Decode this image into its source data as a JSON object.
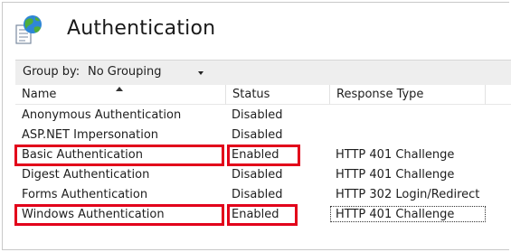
{
  "page": {
    "title": "Authentication"
  },
  "toolbar": {
    "group_by_label": "Group by:",
    "group_by_value": "No Grouping"
  },
  "columns": {
    "name": "Name",
    "status": "Status",
    "response_type": "Response Type"
  },
  "rows": [
    {
      "name": "Anonymous Authentication",
      "status": "Disabled",
      "response_type": ""
    },
    {
      "name": "ASP.NET Impersonation",
      "status": "Disabled",
      "response_type": ""
    },
    {
      "name": "Basic Authentication",
      "status": "Enabled",
      "response_type": "HTTP 401 Challenge",
      "highlighted": true
    },
    {
      "name": "Digest Authentication",
      "status": "Disabled",
      "response_type": "HTTP 401 Challenge"
    },
    {
      "name": "Forms Authentication",
      "status": "Disabled",
      "response_type": "HTTP 302 Login/Redirect"
    },
    {
      "name": "Windows Authentication",
      "status": "Enabled",
      "response_type": "HTTP 401 Challenge",
      "highlighted": true,
      "focused": true
    }
  ],
  "colors": {
    "highlight": "#e2001a",
    "toolbar_bg": "#eeeeee"
  },
  "icons": {
    "page_icon": "globe-document-icon",
    "sort": "sort-ascending-icon",
    "dropdown": "chevron-down-icon"
  }
}
